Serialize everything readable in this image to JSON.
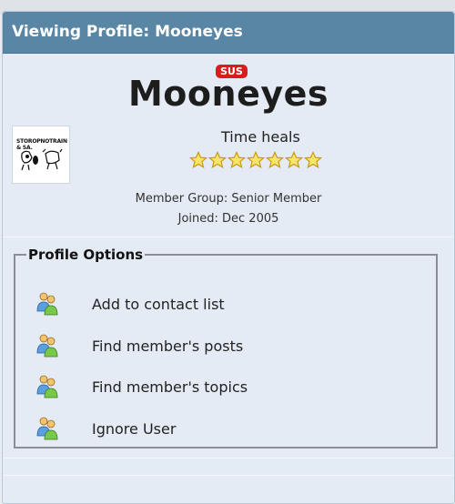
{
  "header": {
    "title": "Viewing Profile: Mooneyes"
  },
  "profile": {
    "badge": "SUS",
    "username": "Mooneyes",
    "avatar_alt": "STOROPNOTRAIN & SA.",
    "tagline": "Time heals",
    "rating_stars": 7,
    "member_group": "Member Group: Senior Member",
    "joined": "Joined: Dec 2005"
  },
  "options": {
    "legend": "Profile Options",
    "items": [
      {
        "label": "Add to contact list",
        "icon": "users-icon"
      },
      {
        "label": "Find member's posts",
        "icon": "users-icon"
      },
      {
        "label": "Find member's topics",
        "icon": "users-icon"
      },
      {
        "label": "Ignore User",
        "icon": "users-icon"
      }
    ]
  },
  "colors": {
    "header_bg": "#5a86a5",
    "card_bg": "#e4ebf4",
    "badge_bg": "#d71d1d",
    "star_fill": "#f7e46a"
  }
}
